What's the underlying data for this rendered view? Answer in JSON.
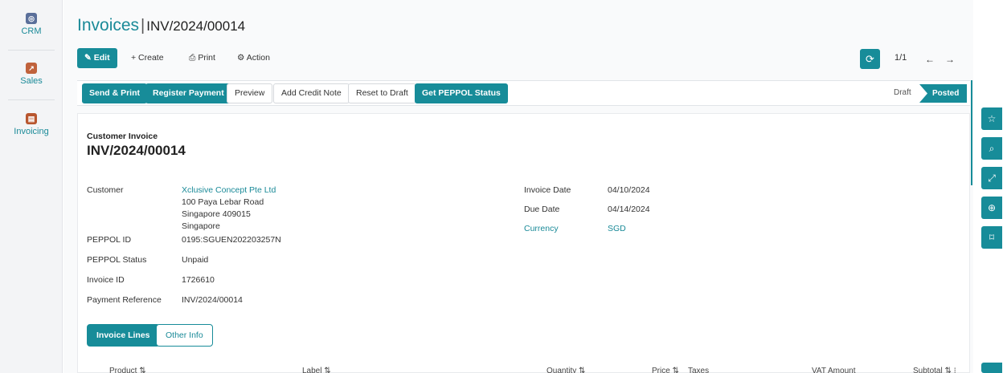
{
  "rail": {
    "items": [
      {
        "label": "CRM",
        "icon": "crm-icon"
      },
      {
        "label": "Sales",
        "icon": "sales-chart-icon"
      },
      {
        "label": "Invoicing",
        "icon": "invoice-icon"
      }
    ]
  },
  "breadcrumb": {
    "parent": "Invoices",
    "separator": "|",
    "current": "INV/2024/00014"
  },
  "toolbar": {
    "edit": "Edit",
    "create": "+ Create",
    "print": "Print",
    "action": "Action"
  },
  "pager": {
    "text": "1/1",
    "prev": "←",
    "next": "→"
  },
  "action_bar": {
    "send_print": "Send & Print",
    "register_payment": "Register Payment",
    "preview": "Preview",
    "add_credit_note": "Add Credit Note",
    "reset_to_draft": "Reset to Draft",
    "get_peppol_status": "Get PEPPOL Status",
    "status_draft": "Draft",
    "status_posted": "Posted"
  },
  "invoice": {
    "kind": "Customer Invoice",
    "name": "INV/2024/00014",
    "customer_label": "Customer",
    "customer_name": "Xclusive Concept Pte Ltd",
    "address_line1": "100 Paya Lebar Road",
    "address_line2": "Singapore 409015",
    "address_line3": "Singapore",
    "peppol_id_label": "PEPPOL ID",
    "peppol_id": "0195:SGUEN202203257N",
    "peppol_status_label": "PEPPOL Status",
    "peppol_status": "Unpaid",
    "invoice_id_label": "Invoice ID",
    "invoice_id": "1726610",
    "payment_ref_label": "Payment Reference",
    "payment_ref": "INV/2024/00014",
    "invoice_date_label": "Invoice Date",
    "invoice_date": "04/10/2024",
    "due_date_label": "Due Date",
    "due_date": "04/14/2024",
    "currency_label": "Currency",
    "currency": "SGD"
  },
  "tabs": {
    "lines": "Invoice Lines",
    "other": "Other Info"
  },
  "columns": {
    "product": "Product ⇅",
    "label": "Label ⇅",
    "quantity": "Quantity ⇅",
    "price": "Price ⇅",
    "taxes": "Taxes",
    "vat_amount": "VAT Amount",
    "subtotal": "Subtotal ⇅ ⁝"
  },
  "colors": {
    "accent": "#178c99",
    "link": "#1a8a98"
  }
}
